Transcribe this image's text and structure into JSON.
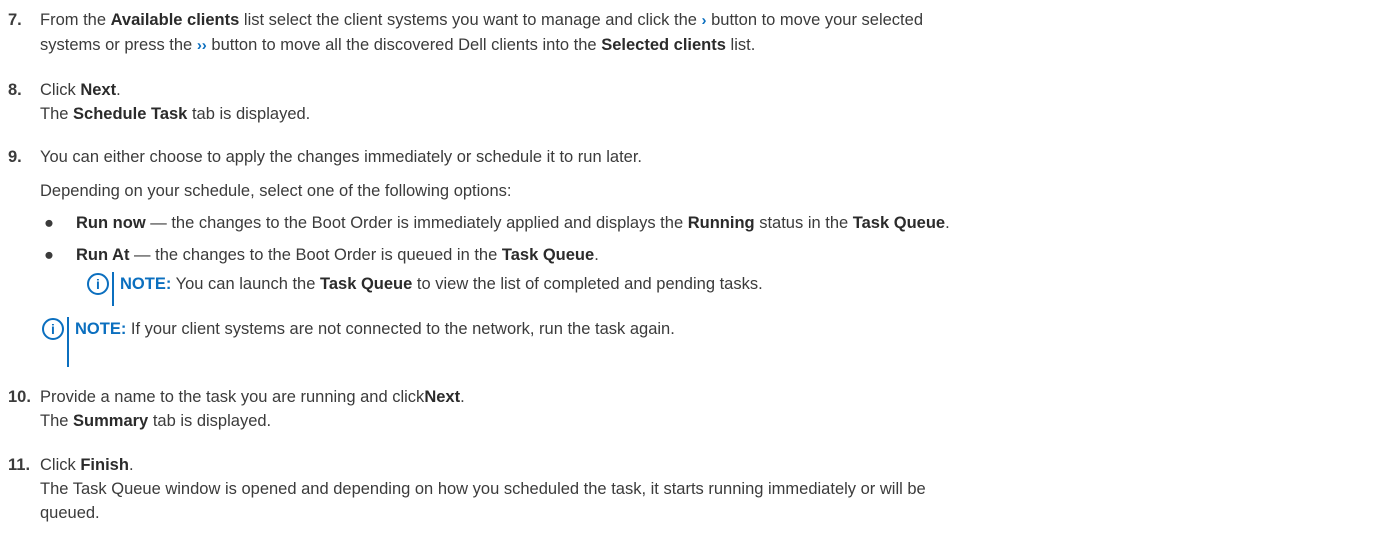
{
  "steps": {
    "s7": {
      "num": "7.",
      "t1": "From the ",
      "b1": "Available clients",
      "t2": " list select the client systems you want to manage and click the ",
      "icon1": "›",
      "t3": " button to move your selected",
      "t4": "systems or press the ",
      "icon2": "››",
      "t5": " button to move all the discovered Dell clients into the ",
      "b2": "Selected clients",
      "t6": " list."
    },
    "s8": {
      "num": "8.",
      "t1": "Click ",
      "b1": "Next",
      "t2": ".",
      "t3": "The ",
      "b2": "Schedule Task",
      "t4": " tab is displayed."
    },
    "s9": {
      "num": "9.",
      "t1": "You can either choose to apply the changes immediately or schedule it to run later.",
      "t2": "Depending on your schedule, select one of the following options:",
      "bullet1": {
        "mark": "●",
        "b1": "Run now",
        "t1": " — the changes to the Boot Order is immediately applied and displays the ",
        "b2": "Running",
        "t2": " status in the ",
        "b3": "Task Queue",
        "t3": "."
      },
      "bullet2": {
        "mark": "●",
        "b1": "Run At",
        "t1": " — the changes to the Boot Order is queued in the ",
        "b2": "Task Queue",
        "t2": "."
      },
      "note1": {
        "label": "NOTE:",
        "t1": " You can launch the ",
        "b1": "Task Queue",
        "t2": " to view the list of completed and pending tasks."
      },
      "note2": {
        "label": "NOTE:",
        "t1": " If your client systems are not connected to the network, run the task again."
      }
    },
    "s10": {
      "num": "10.",
      "t1": "Provide a name to the task you are running and click",
      "b1": "Next",
      "t2": ".",
      "t3": "The ",
      "b2": "Summary",
      "t4": " tab is displayed."
    },
    "s11": {
      "num": "11.",
      "t1": "Click ",
      "b1": "Finish",
      "t2": ".",
      "t3": "The Task Queue window is opened and depending on how you scheduled the task, it starts running immediately or will be",
      "t4": "queued."
    }
  },
  "icons": {
    "info": "i"
  },
  "colors": {
    "accent": "#0b6fbf",
    "text": "#3b3b3b"
  }
}
